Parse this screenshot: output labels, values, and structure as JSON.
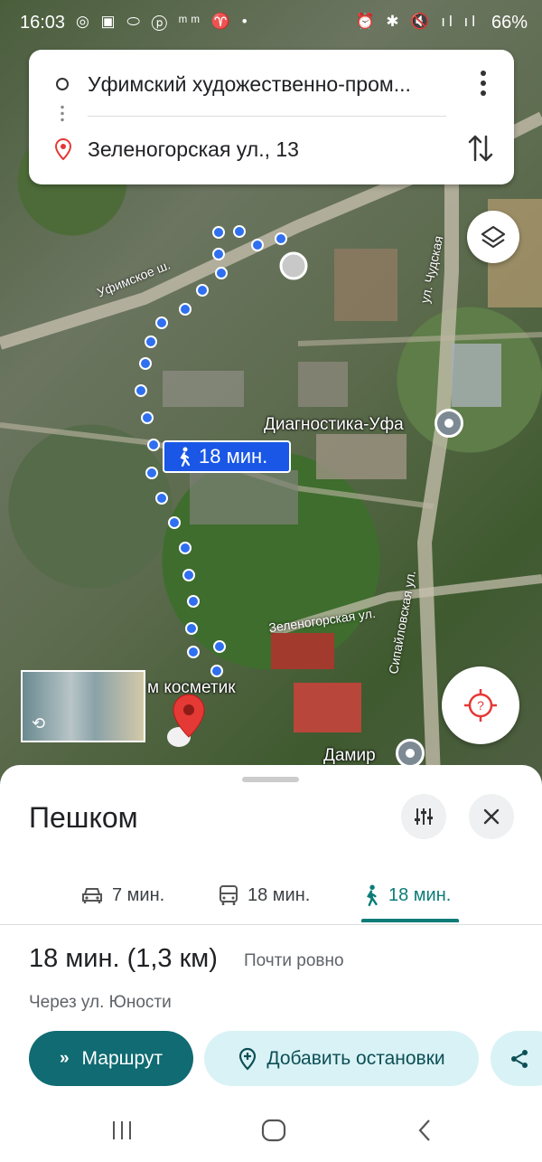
{
  "status_bar": {
    "time": "16:03",
    "battery": "66%",
    "notification_icons": [
      "instagram-icon",
      "chat-icon",
      "oval-app-icon",
      "pinterest-icon",
      "mm-icon",
      "ribbon-icon",
      "dot-icon"
    ],
    "system_icons": [
      "alarm-icon",
      "bluetooth-icon",
      "mute-icon",
      "signal-icon"
    ]
  },
  "directions": {
    "origin": "Уфимский художественно-пром...",
    "destination": "Зеленогорская ул., 13"
  },
  "map": {
    "route_duration": "18 мин.",
    "labels": {
      "diagnostika": "Диагностика-Уфа",
      "damir": "Дамир",
      "kosmetik": "м косметик"
    },
    "roads": {
      "ufimskoe": "Уфимское ш.",
      "chudskaya": "ул. Чудская",
      "zelenogorskaya": "Зеленогорская ул.",
      "sipailovskaya": "Сипайловская ул."
    },
    "route_color": "#1a57e6"
  },
  "sheet": {
    "title": "Пешком",
    "modes": [
      {
        "icon": "car-icon",
        "label": "7 мин."
      },
      {
        "icon": "transit-icon",
        "label": "18 мин."
      },
      {
        "icon": "walk-icon",
        "label": "18 мин.",
        "selected": true
      }
    ],
    "summary": "18 мин. (1,3 км)",
    "summary_note": "Почти ровно",
    "via": "Через ул. Юности",
    "route_button": "Маршрут",
    "add_stops_button": "Добавить остановки"
  },
  "colors": {
    "accent": "#106b72",
    "selected_mode": "#0b7c77",
    "pin": "#e53935"
  }
}
